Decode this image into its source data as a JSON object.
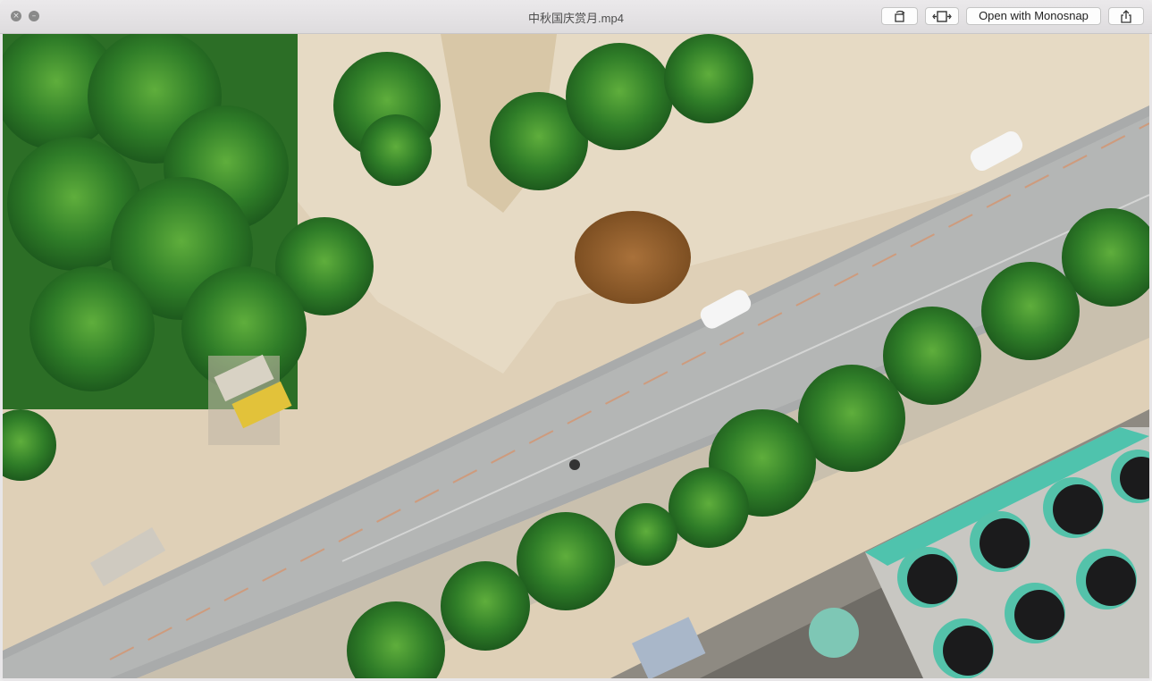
{
  "window": {
    "title": "中秋国庆赏月.mp4",
    "close_glyph": "×",
    "minimize_glyph": "–"
  },
  "toolbar": {
    "rotate_icon": "rotate-icon",
    "trim_icon": "trim-icon",
    "open_with_label": "Open with Monosnap",
    "share_icon": "share-icon"
  },
  "video": {
    "description_icon": "video-frame"
  }
}
